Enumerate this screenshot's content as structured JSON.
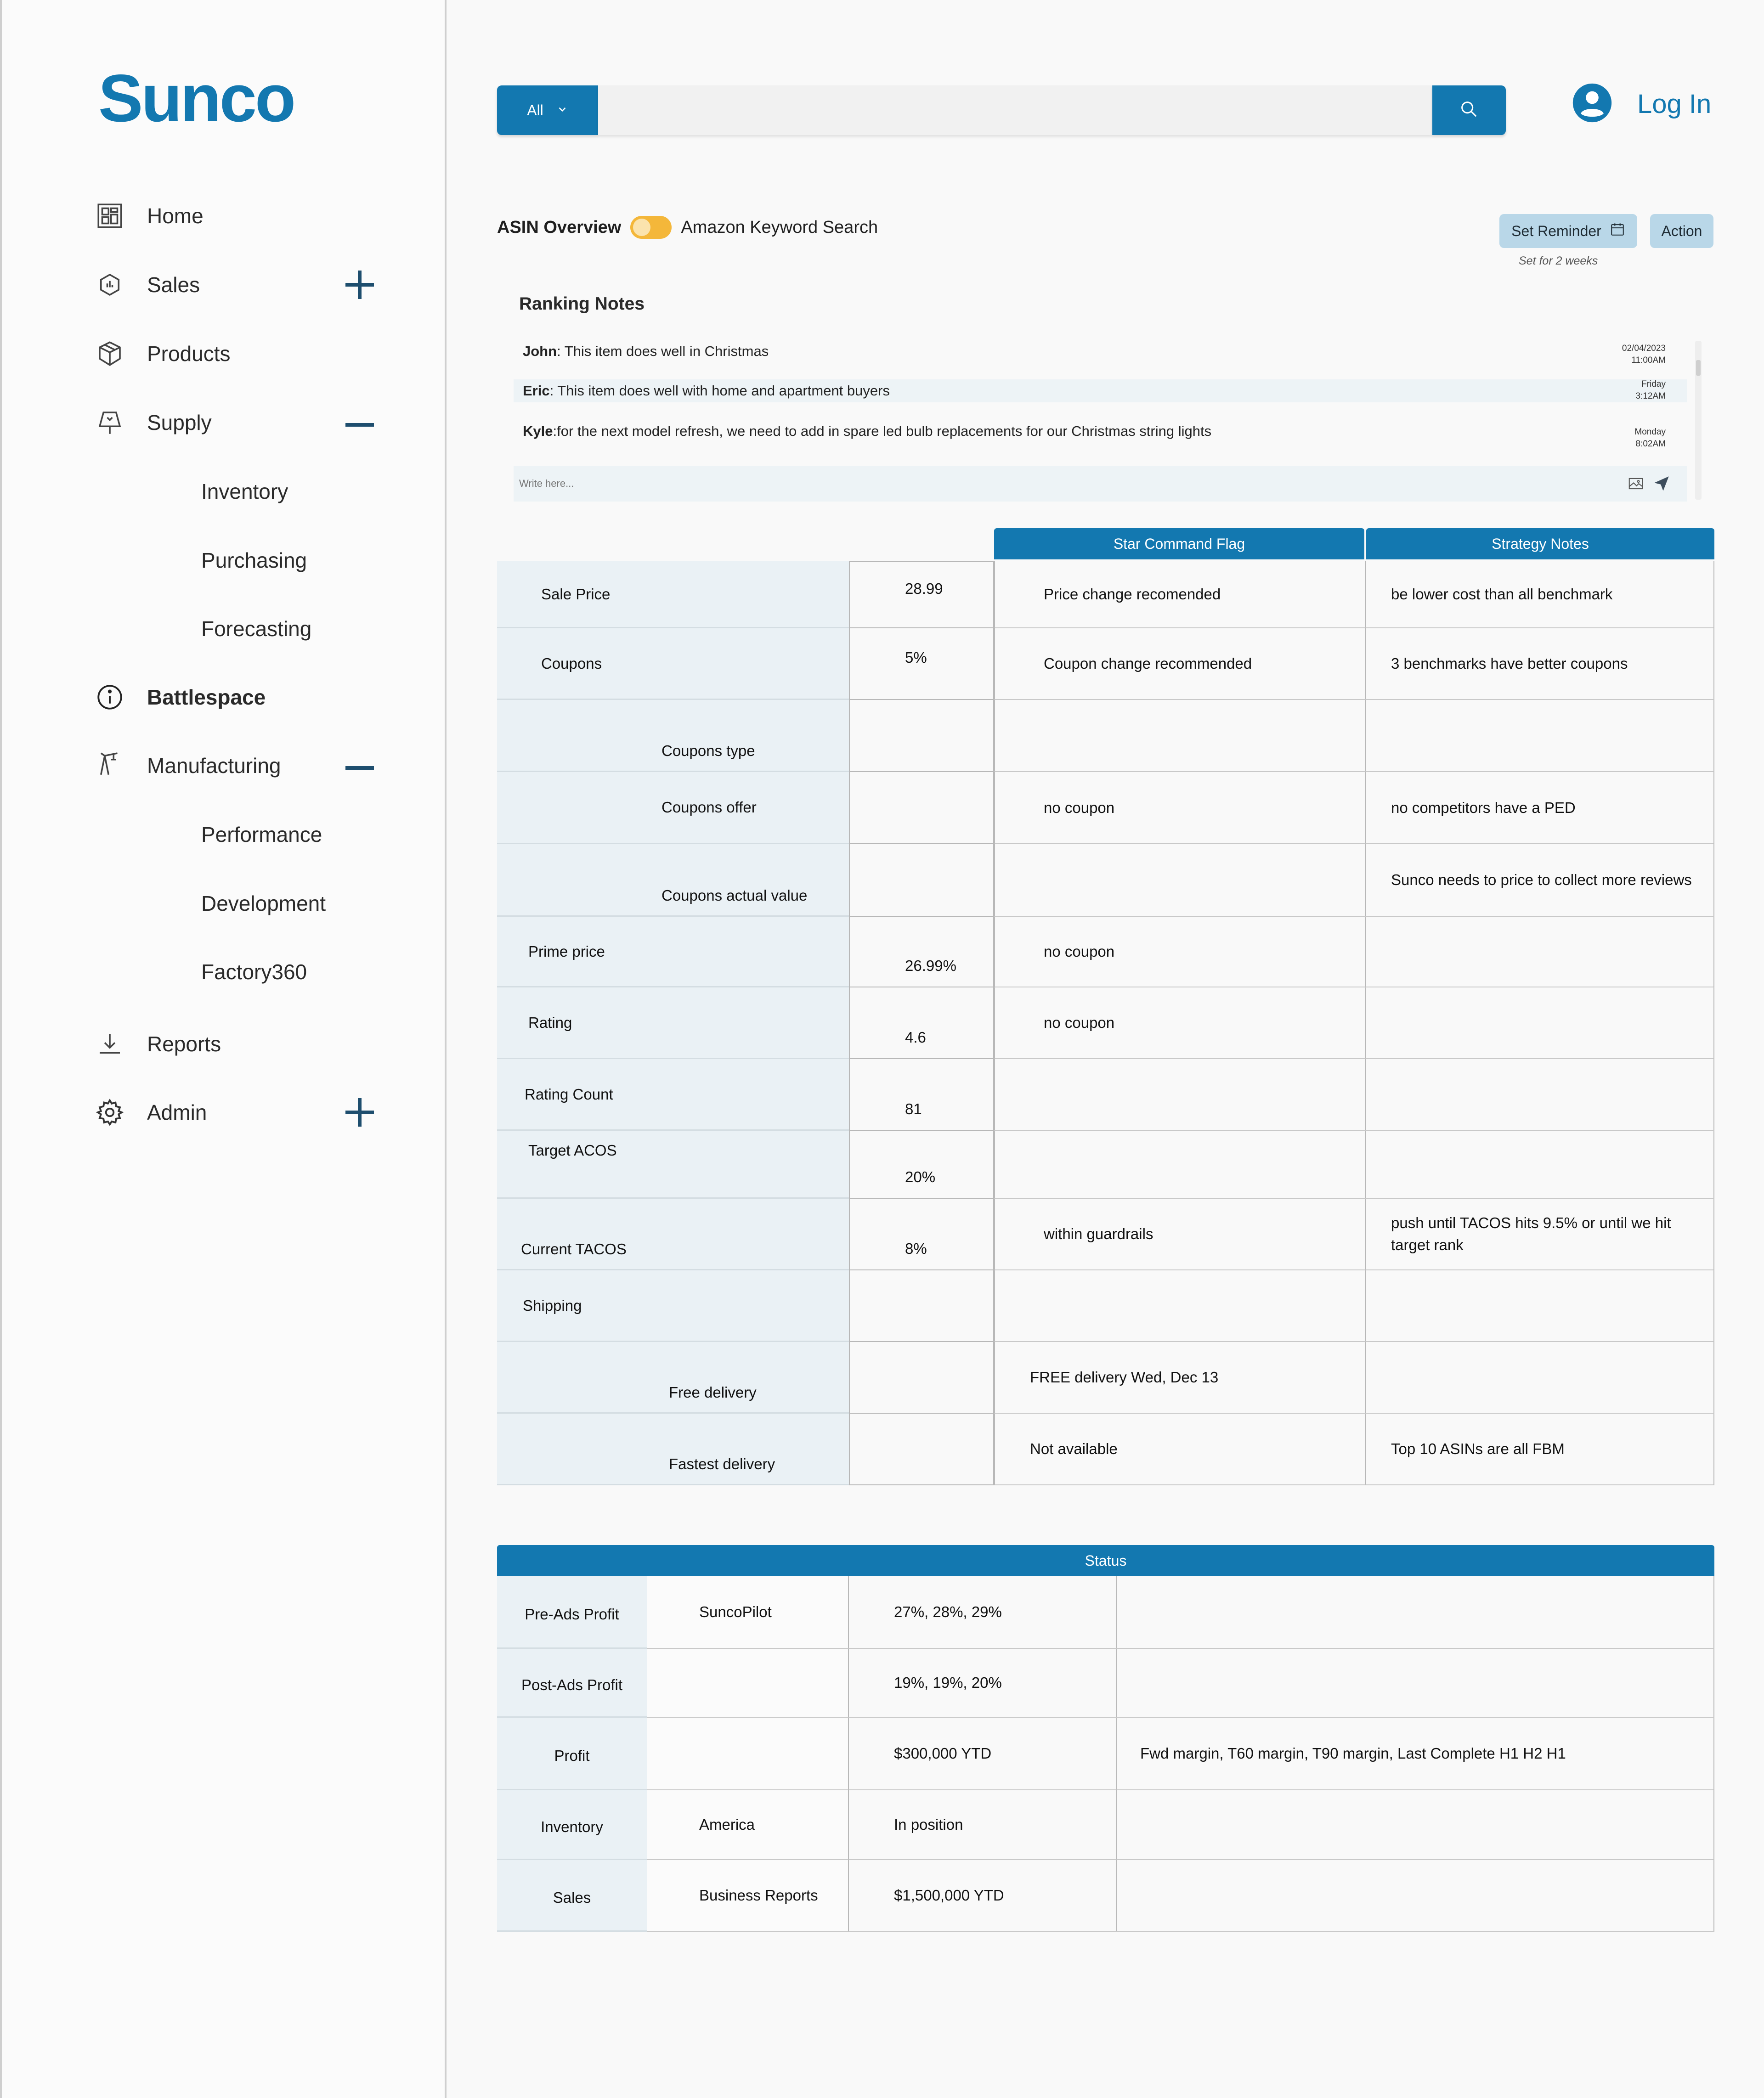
{
  "app": {
    "logo": "Sunco"
  },
  "sidebar": {
    "items": [
      {
        "label": "Home",
        "icon": "dashboard-icon"
      },
      {
        "label": "Sales",
        "icon": "sales-icon",
        "toggle": "plus"
      },
      {
        "label": "Products",
        "icon": "box-icon"
      },
      {
        "label": "Supply",
        "icon": "supply-icon",
        "toggle": "minus"
      },
      {
        "label": "Inventory"
      },
      {
        "label": "Purchasing"
      },
      {
        "label": "Forecasting"
      },
      {
        "label": "Battlespace",
        "icon": "info-icon"
      },
      {
        "label": "Manufacturing",
        "icon": "crane-icon",
        "toggle": "minus"
      },
      {
        "label": "Performance"
      },
      {
        "label": "Development"
      },
      {
        "label": "Factory360"
      },
      {
        "label": "Reports",
        "icon": "download-icon"
      },
      {
        "label": "Admin",
        "icon": "gear-icon",
        "toggle": "plus"
      }
    ]
  },
  "search": {
    "category": "All",
    "placeholder": ""
  },
  "auth": {
    "login_label": "Log In"
  },
  "overview": {
    "asin_label": "ASIN Overview",
    "keyword_label": "Amazon Keyword Search",
    "set_reminder": "Set Reminder",
    "action": "Action",
    "reminder_note": "Set for 2 weeks"
  },
  "notes": {
    "title": "Ranking Notes",
    "items": [
      {
        "author": "John",
        "text": ": This item does well in Christmas",
        "date": "02/04/2023",
        "time": "11:00AM"
      },
      {
        "author": "Eric",
        "text": ": This item does well with home and apartment buyers",
        "date": "Friday",
        "time": "3:12AM"
      },
      {
        "author": "Kyle",
        "text": ":for the next model refresh, we need to add in spare led bulb replacements for our Christmas string lights",
        "date": "Monday",
        "time": "8:02AM"
      }
    ],
    "input_placeholder": "Write here..."
  },
  "main_table": {
    "headers": {
      "flag": "Star Command Flag",
      "strategy": "Strategy Notes"
    },
    "rows": [
      {
        "label": "Sale Price",
        "value": "28.99",
        "flag": "Price change recomended",
        "strategy": "be lower cost than all benchmark"
      },
      {
        "label": "Coupons",
        "value": "5%",
        "flag": "Coupon change recommended",
        "strategy": "3 benchmarks have better coupons"
      },
      {
        "label": "Coupons type",
        "value": "",
        "flag": "",
        "strategy": ""
      },
      {
        "label": "Coupons offer",
        "value": "",
        "flag": "no coupon",
        "strategy": "no competitors have a PED"
      },
      {
        "label": "Coupons actual value",
        "value": "",
        "flag": "",
        "strategy": "Sunco needs to price to collect more reviews"
      },
      {
        "label": "Prime price",
        "value": "26.99%",
        "flag": "no coupon",
        "strategy": ""
      },
      {
        "label": "Rating",
        "value": "4.6",
        "flag": "no coupon",
        "strategy": ""
      },
      {
        "label": "Rating Count",
        "value": "81",
        "flag": "",
        "strategy": ""
      },
      {
        "label": "Target ACOS",
        "value": "20%",
        "flag": "",
        "strategy": ""
      },
      {
        "label": "Current TACOS",
        "value": "8%",
        "flag": "within guardrails",
        "strategy": "push until TACOS hits 9.5% or until we hit target rank"
      },
      {
        "label": "Shipping",
        "value": "",
        "flag": "",
        "strategy": ""
      },
      {
        "label": "Free delivery",
        "value": "",
        "flag": "FREE delivery Wed, Dec 13",
        "strategy": ""
      },
      {
        "label": "Fastest delivery",
        "value": "",
        "flag": "Not available",
        "strategy": "Top 10 ASINs are all FBM"
      }
    ]
  },
  "status_table": {
    "header": "Status",
    "rows": [
      {
        "label": "Pre-Ads Profit",
        "source": "SuncoPilot",
        "value": "27%, 28%, 29%",
        "note": ""
      },
      {
        "label": "Post-Ads Profit",
        "source": "",
        "value": "19%, 19%, 20%",
        "note": ""
      },
      {
        "label": "Profit",
        "source": "",
        "value": "$300,000 YTD",
        "note": "Fwd margin, T60 margin, T90 margin, Last Complete H1 H2 H1"
      },
      {
        "label": "Inventory",
        "source": "America",
        "value": "In position",
        "note": ""
      },
      {
        "label": "Sales",
        "source": "Business Reports",
        "value": "$1,500,000 YTD",
        "note": ""
      }
    ]
  },
  "colors": {
    "brand": "#1378b0",
    "label_bg": "#eaf1f5",
    "toggle": "#f4b73a",
    "pill": "#b9d7e8"
  }
}
